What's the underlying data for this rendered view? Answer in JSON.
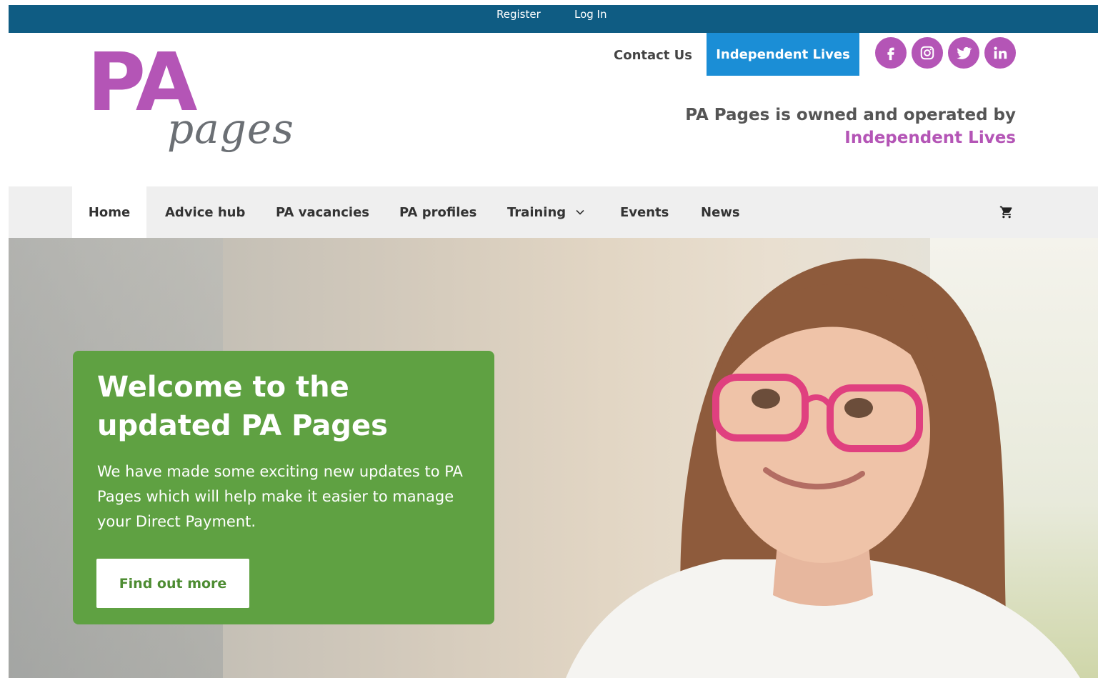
{
  "topbar": {
    "register": "Register",
    "login": "Log In"
  },
  "logo": {
    "pa": "PA",
    "pages": "pages"
  },
  "header": {
    "contact_us": "Contact Us",
    "independent_lives_button": "Independent Lives",
    "owned_line1": "PA Pages is owned and operated by",
    "owned_line2": "Independent Lives"
  },
  "social": [
    "facebook-icon",
    "instagram-icon",
    "twitter-icon",
    "linkedin-icon"
  ],
  "nav": {
    "items": [
      {
        "label": "Home"
      },
      {
        "label": "Advice hub"
      },
      {
        "label": "PA vacancies"
      },
      {
        "label": "PA profiles"
      },
      {
        "label": "Training"
      },
      {
        "label": "Events"
      },
      {
        "label": "News"
      }
    ],
    "cart_icon": "cart-icon"
  },
  "hero": {
    "title": "Welcome to the updated PA Pages",
    "body": "We have made some exciting new updates to PA Pages which will help make it easier to manage your Direct Payment.",
    "button": "Find out more"
  },
  "colors": {
    "brand_purple": "#b455b6",
    "topbar_blue": "#0f5c83",
    "button_blue": "#1b8ed6",
    "card_green": "#5fa142"
  }
}
